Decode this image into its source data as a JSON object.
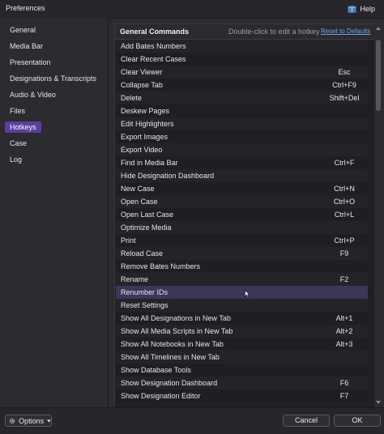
{
  "window": {
    "title": "Preferences",
    "help_label": "Help"
  },
  "sidebar": {
    "items": [
      {
        "label": "General"
      },
      {
        "label": "Media Bar"
      },
      {
        "label": "Presentation"
      },
      {
        "label": "Designations & Transcripts"
      },
      {
        "label": "Audio & Video"
      },
      {
        "label": "Files"
      },
      {
        "label": "Hotkeys",
        "active": true
      },
      {
        "label": "Case"
      },
      {
        "label": "Log"
      }
    ]
  },
  "panel": {
    "title": "General Commands",
    "hint": "Double-click to edit a hotkey",
    "reset_label": "Reset to Defaults",
    "rows": [
      {
        "command": "Add Bates Numbers",
        "hotkey": ""
      },
      {
        "command": "Clear Recent Cases",
        "hotkey": ""
      },
      {
        "command": "Clear Viewer",
        "hotkey": "Esc"
      },
      {
        "command": "Collapse Tab",
        "hotkey": "Ctrl+F9"
      },
      {
        "command": "Delete",
        "hotkey": "Shift+Del"
      },
      {
        "command": "Deskew Pages",
        "hotkey": ""
      },
      {
        "command": "Edit Highlighters",
        "hotkey": ""
      },
      {
        "command": "Export Images",
        "hotkey": ""
      },
      {
        "command": "Export Video",
        "hotkey": ""
      },
      {
        "command": "Find in Media Bar",
        "hotkey": "Ctrl+F"
      },
      {
        "command": "Hide Designation Dashboard",
        "hotkey": ""
      },
      {
        "command": "New Case",
        "hotkey": "Ctrl+N"
      },
      {
        "command": "Open Case",
        "hotkey": "Ctrl+O"
      },
      {
        "command": "Open Last Case",
        "hotkey": "Ctrl+L"
      },
      {
        "command": "Optimize Media",
        "hotkey": ""
      },
      {
        "command": "Print",
        "hotkey": "Ctrl+P"
      },
      {
        "command": "Reload Case",
        "hotkey": "F9"
      },
      {
        "command": "Remove Bates Numbers",
        "hotkey": ""
      },
      {
        "command": "Rename",
        "hotkey": "F2"
      },
      {
        "command": "Renumber IDs",
        "hotkey": "",
        "selected": true
      },
      {
        "command": "Reset Settings",
        "hotkey": ""
      },
      {
        "command": "Show All Designations in New Tab",
        "hotkey": "Alt+1"
      },
      {
        "command": "Show All Media Scripts in New Tab",
        "hotkey": "Alt+2"
      },
      {
        "command": "Show All Notebooks in New Tab",
        "hotkey": "Alt+3"
      },
      {
        "command": "Show All Timelines in New Tab",
        "hotkey": ""
      },
      {
        "command": "Show Database Tools",
        "hotkey": ""
      },
      {
        "command": "Show Designation Dashboard",
        "hotkey": "F6"
      },
      {
        "command": "Show Designation Editor",
        "hotkey": "F7"
      }
    ]
  },
  "footer": {
    "options_label": "Options",
    "cancel_label": "Cancel",
    "ok_label": "OK"
  },
  "colors": {
    "accent": "#5b3f9e",
    "link": "#6ea3ea",
    "selected_row": "#3d3657"
  },
  "icons": {
    "help": "book-icon",
    "options": "gear-icon",
    "options_caret": "caret-down-icon",
    "pointer": "mouse-cursor-icon"
  }
}
